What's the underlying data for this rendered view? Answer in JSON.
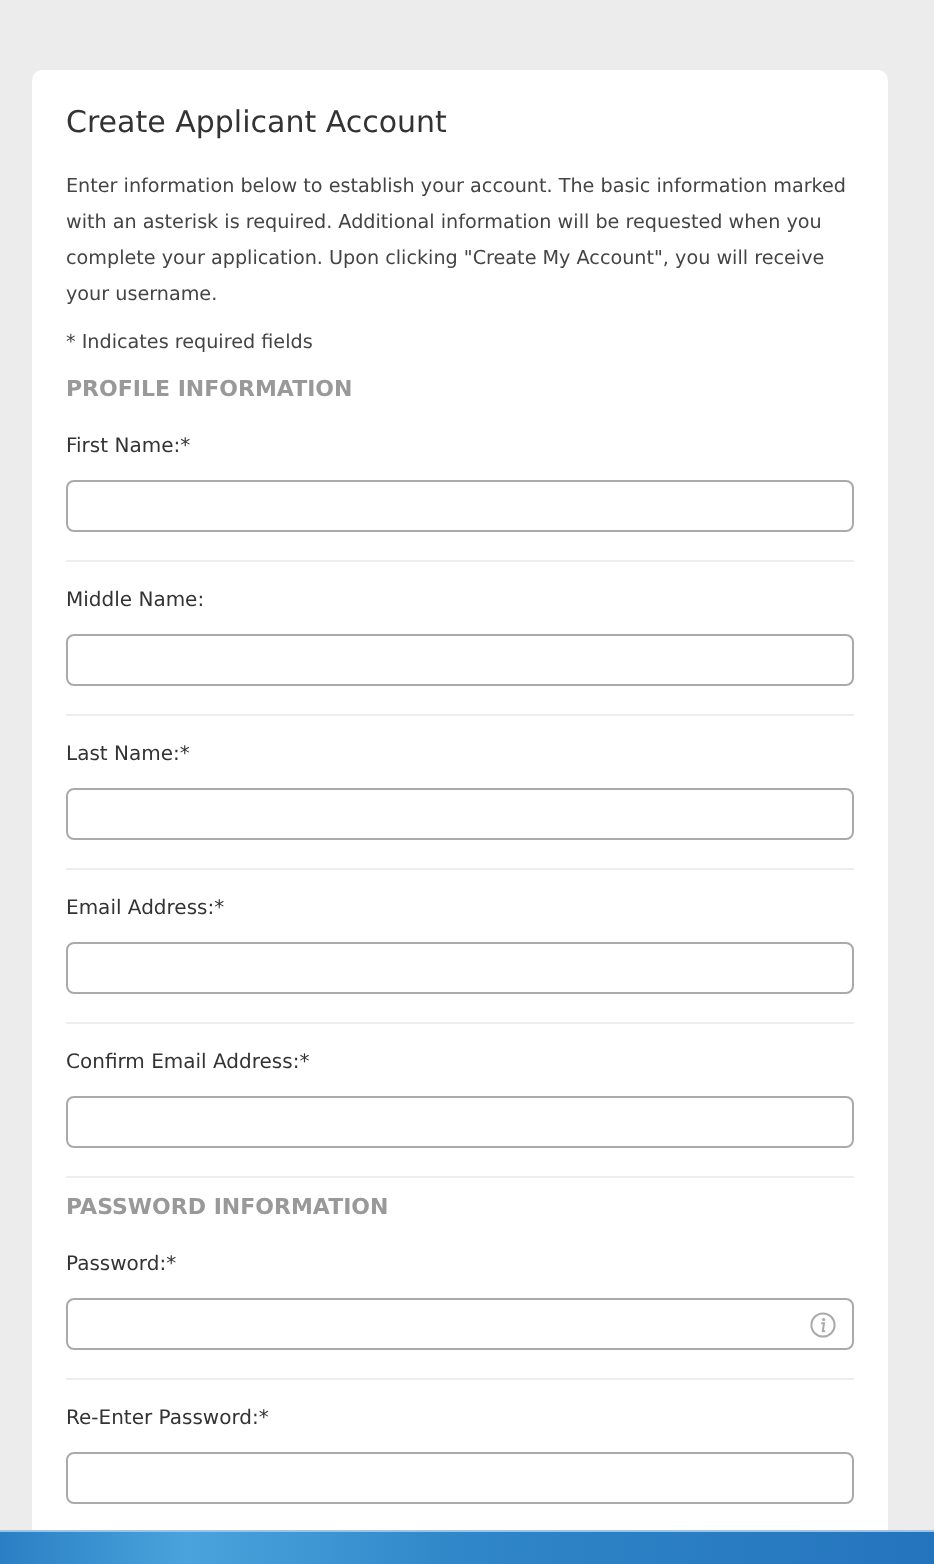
{
  "title": "Create Applicant Account",
  "intro": "Enter information below to establish your account. The basic information marked with an asterisk is required. Additional information will be requested when you complete your application. Upon clicking \"Create My Account\", you will receive your username.",
  "required_note": "* Indicates required fields",
  "sections": [
    {
      "heading": "PROFILE INFORMATION",
      "fields": [
        {
          "label": "First Name:*",
          "kind": "text"
        },
        {
          "label": "Middle Name:",
          "kind": "text"
        },
        {
          "label": "Last Name:*",
          "kind": "text"
        },
        {
          "label": "Email Address:*",
          "kind": "text"
        },
        {
          "label": "Confirm Email Address:*",
          "kind": "text"
        }
      ]
    },
    {
      "heading": "PASSWORD INFORMATION",
      "fields": [
        {
          "label": "Password:*",
          "kind": "password_info"
        },
        {
          "label": "Re-Enter Password:*",
          "kind": "password"
        }
      ]
    }
  ]
}
